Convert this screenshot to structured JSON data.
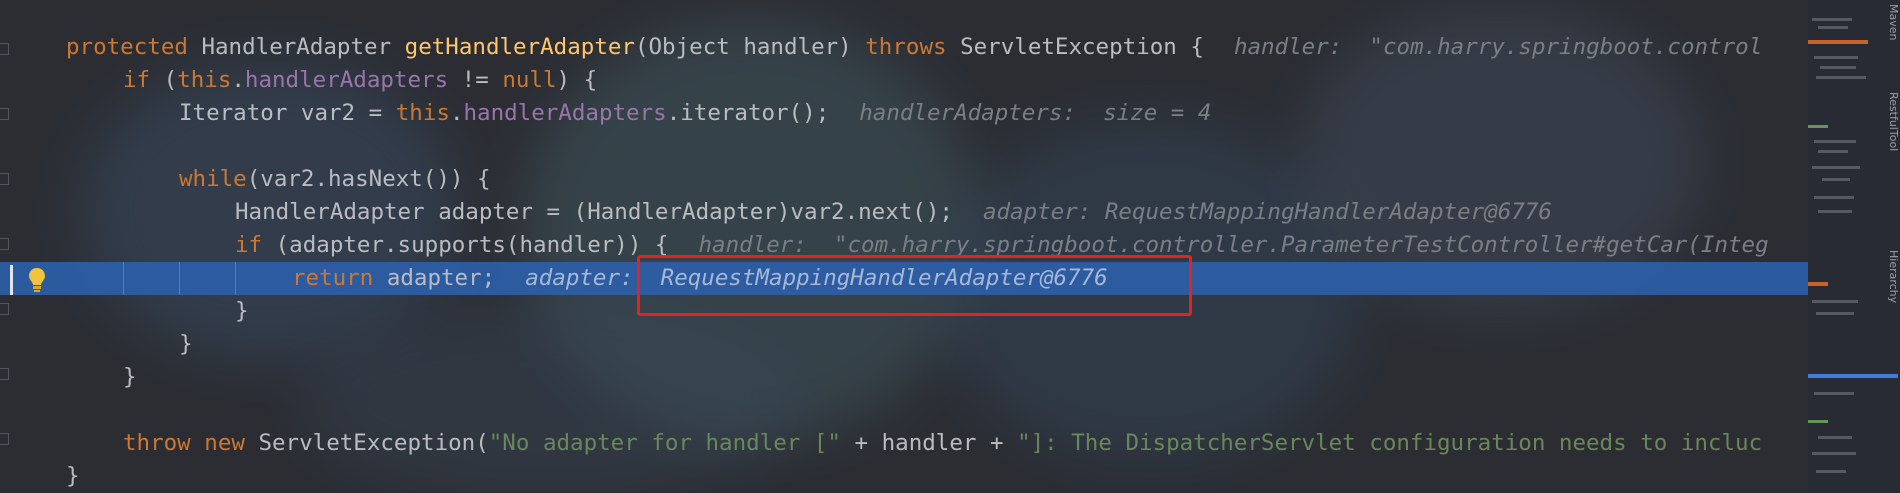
{
  "editor": {
    "lines": [
      {
        "tokens": [
          {
            "t": "protected ",
            "c": "kw"
          },
          {
            "t": "HandlerAdapter ",
            "c": "plain"
          },
          {
            "t": "getHandlerAdapter",
            "c": "fn"
          },
          {
            "t": "(Object handler) ",
            "c": "plain"
          },
          {
            "t": "throws ",
            "c": "kw"
          },
          {
            "t": "ServletException {",
            "c": "plain"
          }
        ],
        "hint": "handler:  \"com.harry.springboot.control"
      },
      {
        "tokens": [
          {
            "t": "if ",
            "c": "kw"
          },
          {
            "t": "(",
            "c": "plain"
          },
          {
            "t": "this",
            "c": "kw"
          },
          {
            "t": ".",
            "c": "plain"
          },
          {
            "t": "handlerAdapters",
            "c": "fld"
          },
          {
            "t": " != ",
            "c": "plain"
          },
          {
            "t": "null",
            "c": "kw"
          },
          {
            "t": ") {",
            "c": "plain"
          }
        ],
        "hint": ""
      },
      {
        "tokens": [
          {
            "t": "Iterator var2 = ",
            "c": "plain"
          },
          {
            "t": "this",
            "c": "kw"
          },
          {
            "t": ".",
            "c": "plain"
          },
          {
            "t": "handlerAdapters",
            "c": "fld"
          },
          {
            "t": ".iterator();",
            "c": "plain"
          }
        ],
        "hint": "handlerAdapters:  size = 4"
      },
      {
        "tokens": [],
        "hint": ""
      },
      {
        "tokens": [
          {
            "t": "while",
            "c": "kw"
          },
          {
            "t": "(var2.hasNext()) {",
            "c": "plain"
          }
        ],
        "hint": ""
      },
      {
        "tokens": [
          {
            "t": "HandlerAdapter adapter = (HandlerAdapter)var2.next();",
            "c": "plain"
          }
        ],
        "hint": "adapter: RequestMappingHandlerAdapter@6776"
      },
      {
        "tokens": [
          {
            "t": "if ",
            "c": "kw"
          },
          {
            "t": "(adapter.supports(handler)) {",
            "c": "plain"
          }
        ],
        "hint": "handler:  \"com.harry.springboot.controller.ParameterTestController#getCar(Integ"
      },
      {
        "tokens": [
          {
            "t": "return ",
            "c": "kw"
          },
          {
            "t": "adapter;",
            "c": "plain"
          }
        ],
        "hint": "adapter:  RequestMappingHandlerAdapter@6776"
      },
      {
        "tokens": [
          {
            "t": "}",
            "c": "plain"
          }
        ],
        "hint": ""
      },
      {
        "tokens": [
          {
            "t": "}",
            "c": "plain"
          }
        ],
        "hint": ""
      },
      {
        "tokens": [
          {
            "t": "}",
            "c": "plain"
          }
        ],
        "hint": ""
      },
      {
        "tokens": [],
        "hint": ""
      },
      {
        "tokens": [
          {
            "t": "throw ",
            "c": "kw"
          },
          {
            "t": "new ",
            "c": "kw"
          },
          {
            "t": "ServletException(",
            "c": "plain"
          },
          {
            "t": "\"No adapter for handler [\"",
            "c": "str"
          },
          {
            "t": " + handler + ",
            "c": "plain"
          },
          {
            "t": "\"]: The DispatcherServlet configuration needs to incluc",
            "c": "str"
          }
        ],
        "hint": ""
      },
      {
        "tokens": [
          {
            "t": "}",
            "c": "plain"
          }
        ],
        "hint": ""
      }
    ],
    "current_line_index": 7
  },
  "side_panel": {
    "tabs": [
      "Maven",
      "RestfulTool",
      "Hierarchy"
    ]
  },
  "colors": {
    "keyword": "#cc7832",
    "method": "#ffc66d",
    "field": "#9876aa",
    "string": "#6a8759",
    "execution_line": "#2c5ea8",
    "annotation_box": "#e3231f"
  }
}
